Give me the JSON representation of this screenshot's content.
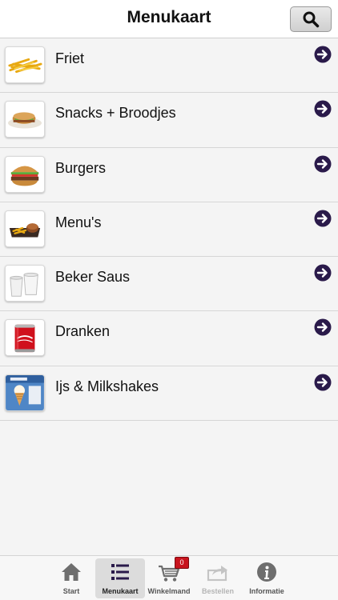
{
  "header": {
    "title": "Menukaart",
    "search_icon": "search-icon"
  },
  "menu": {
    "items": [
      {
        "label": "Friet",
        "icon": "fries-thumbnail"
      },
      {
        "label": "Snacks + Broodjes",
        "icon": "snacks-thumbnail"
      },
      {
        "label": "Burgers",
        "icon": "burger-thumbnail"
      },
      {
        "label": "Menu's",
        "icon": "menu-tray-thumbnail"
      },
      {
        "label": "Beker Saus",
        "icon": "sauce-cups-thumbnail"
      },
      {
        "label": "Dranken",
        "icon": "cola-can-thumbnail"
      },
      {
        "label": "Ijs & Milkshakes",
        "icon": "ice-cream-thumbnail"
      }
    ],
    "arrow_color": "#2a1a4a"
  },
  "tabbar": {
    "tabs": [
      {
        "label": "Start",
        "icon": "home-icon"
      },
      {
        "label": "Menukaart",
        "icon": "list-icon"
      },
      {
        "label": "Winkelmand",
        "icon": "cart-icon",
        "badge": "0"
      },
      {
        "label": "Bestellen",
        "icon": "share-icon"
      },
      {
        "label": "Informatie",
        "icon": "info-icon"
      }
    ],
    "active_tab": "Menukaart"
  }
}
